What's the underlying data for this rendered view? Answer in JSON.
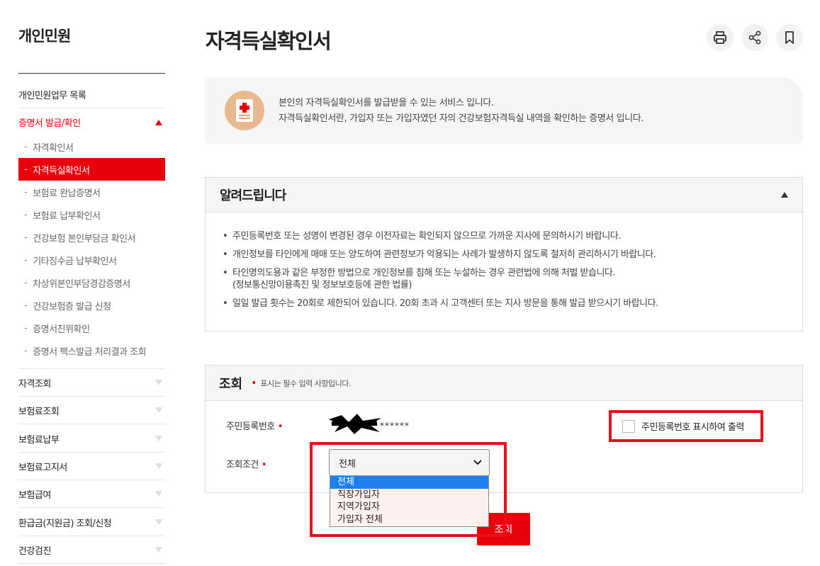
{
  "sidebar": {
    "title": "개인민원",
    "top_item": "개인민원업무 목록",
    "open_section": "증명서 발급/확인",
    "sub_items": [
      "자격확인서",
      "자격득실확인서",
      "보험료 완납증명서",
      "보험료 납부확인서",
      "건강보험 본인부담금 확인서",
      "기타징수금 납부확인서",
      "차상위본인부담경감증명서",
      "건강보험증 발급 신청",
      "증명서진위확인",
      "증명서 팩스발급 처리결과 조회"
    ],
    "active_sub_index": 1,
    "sections": [
      "자격조회",
      "보험료조회",
      "보험료납부",
      "보험료고지서",
      "보험급여",
      "환급금(지원금) 조회/신청",
      "건강검진"
    ]
  },
  "page": {
    "title": "자격득실확인서",
    "tools": [
      "printer-icon",
      "share-icon",
      "bookmark-icon"
    ]
  },
  "intro": {
    "line1": "본인의 자격득실확인서를 발급받을 수 있는 서비스 입니다.",
    "line2": "자격득실확인서란, 가입자 또는 가입자였던 자의 건강보험자격득실 내역을 확인하는 증명서 입니다."
  },
  "notice": {
    "title": "알려드립니다",
    "items": [
      "주민등록번호 또는 성명이 변경된 경우 이전자료는 확인되지 않으므로 가까운 지사에 문의하시기 바랍니다.",
      "개인정보를 타인에게 매매 또는 양도하여 관련정보가 악용되는 사례가 발생하지 않도록 철저히 관리하시기 바랍니다.",
      "타인명의도용과 같은 부정한 방법으로 개인정보를 침해 또는 누설하는 경우 관련법에 의해 처벌 받습니다.",
      "일일 발급 횟수는 20회로 제한되어 있습니다. 20회 초과 시 고객센터 또는 지사 방문을 통해 발급 받으시기 바랍니다."
    ],
    "item3_sub": "(정보통신망이용촉진 및 정보보호등에 관한 법률)"
  },
  "query": {
    "title": "조회",
    "required_note": "표시는 필수 입력 사항입니다.",
    "rrn_label": "주민등록번호",
    "rrn_value": "******",
    "rrn_checkbox_label": "주민등록번호 표시하여 출력",
    "condition_label": "조회조건",
    "condition_selected": "전체",
    "condition_options": [
      "전체",
      "직장가입자",
      "지역가입자",
      "가입자 전체"
    ],
    "submit_label": "조회"
  },
  "colors": {
    "accent": "#e8000b",
    "highlight_box": "#e3121b",
    "dropdown_selected": "#1e7ff0"
  }
}
